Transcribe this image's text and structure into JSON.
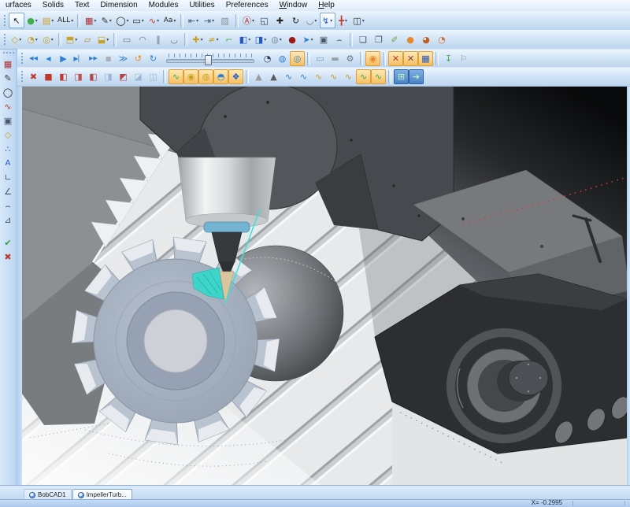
{
  "menubar": {
    "items": [
      {
        "label": "urfaces"
      },
      {
        "label": "Solids"
      },
      {
        "label": "Text"
      },
      {
        "label": "Dimension"
      },
      {
        "label": "Modules"
      },
      {
        "label": "Utilities"
      },
      {
        "label": "Preferences"
      },
      {
        "label": "Window",
        "u": 1
      },
      {
        "label": "Help",
        "u": 1
      }
    ]
  },
  "toolbars": {
    "row1": [
      {
        "t": "g"
      },
      {
        "t": "b",
        "n": "select-arrow-button",
        "g": "↖",
        "c": "#1a1a1a",
        "box": "blue"
      },
      {
        "t": "b",
        "n": "visibility-toggle-button",
        "g": "●",
        "c": "#3fae49",
        "dd": 1
      },
      {
        "t": "b",
        "n": "color-filter-button",
        "g": "▤",
        "c": "#caa020",
        "dd": 1
      },
      {
        "t": "b",
        "n": "selection-mask-dropdown",
        "g": "ALL",
        "c": "#222",
        "dd": 1,
        "fs": 9
      },
      {
        "t": "s"
      },
      {
        "t": "b",
        "n": "layer-manager-button",
        "g": "▦",
        "c": "#b03030",
        "dd": 1
      },
      {
        "t": "b",
        "n": "line-tool-button",
        "g": "✎",
        "c": "#333",
        "dd": 1
      },
      {
        "t": "b",
        "n": "circle-tool-button",
        "g": "◯",
        "c": "#1a1a1a",
        "dd": 1
      },
      {
        "t": "b",
        "n": "rectangle-tool-button",
        "g": "▭",
        "c": "#1a1a1a",
        "dd": 1
      },
      {
        "t": "b",
        "n": "spline-tool-button",
        "g": "∿",
        "c": "#c0392b",
        "dd": 1
      },
      {
        "t": "b",
        "n": "text-tool-button",
        "g": "Aa",
        "c": "#222",
        "dd": 1,
        "fs": 9
      },
      {
        "t": "s"
      },
      {
        "t": "b",
        "n": "dimension-horizontal-button",
        "g": "⇤",
        "c": "#445566",
        "dd": 1
      },
      {
        "t": "b",
        "n": "dimension-vertical-button",
        "g": "⇥",
        "c": "#445566",
        "dd": 1
      },
      {
        "t": "b",
        "n": "hatch-tool-button",
        "g": "▨",
        "c": "#8892a0"
      },
      {
        "t": "s"
      },
      {
        "t": "b",
        "n": "zoom-auto-button",
        "g": "Ⓐ",
        "c": "#b03030",
        "dd": 1
      },
      {
        "t": "b",
        "n": "zoom-window-button",
        "g": "◱",
        "c": "#334455"
      },
      {
        "t": "b",
        "n": "pan-view-button",
        "g": "✚",
        "c": "#222"
      },
      {
        "t": "b",
        "n": "rotate-view-button",
        "g": "↻",
        "c": "#222"
      },
      {
        "t": "b",
        "n": "orbit-view-button",
        "g": "◡",
        "c": "#667788",
        "dd": 1
      },
      {
        "t": "b",
        "n": "dynamic-ucs-button",
        "g": "↯",
        "c": "#2457c5",
        "box": "blue",
        "dd": 1
      },
      {
        "t": "b",
        "n": "axis-origin-button",
        "g": "╋",
        "c": "#c0392b",
        "dd": 1
      },
      {
        "t": "b",
        "n": "view-cube-button",
        "g": "◫",
        "c": "#333",
        "dd": 1
      }
    ],
    "row2": [
      {
        "t": "g"
      },
      {
        "t": "b",
        "n": "surface-plane-button",
        "g": "◇",
        "c": "#caa020",
        "dd": 1
      },
      {
        "t": "b",
        "n": "surface-revolve-button",
        "g": "◔",
        "c": "#caa020",
        "dd": 1
      },
      {
        "t": "b",
        "n": "surface-sweep-button",
        "g": "◎",
        "c": "#caa020",
        "dd": 1
      },
      {
        "t": "s"
      },
      {
        "t": "b",
        "n": "surface-loft-button",
        "g": "⬒",
        "c": "#caa020",
        "dd": 1
      },
      {
        "t": "b",
        "n": "surface-trim-button",
        "g": "▱",
        "c": "#b8860b"
      },
      {
        "t": "b",
        "n": "solid-extract-button",
        "g": "⬓",
        "c": "#caa020",
        "dd": 1
      },
      {
        "t": "s"
      },
      {
        "t": "b",
        "n": "relation-rect-button",
        "g": "▭",
        "c": "#6a7486"
      },
      {
        "t": "b",
        "n": "relation-arc-button",
        "g": "◠",
        "c": "#6a7486"
      },
      {
        "t": "b",
        "n": "relation-align-button",
        "g": "∥",
        "c": "#6a7486"
      },
      {
        "t": "b",
        "n": "relation-tangent-button",
        "g": "◡",
        "c": "#6a7486"
      },
      {
        "t": "s"
      },
      {
        "t": "b",
        "n": "trim-cross-button",
        "g": "✚",
        "c": "#caa020",
        "dd": 1
      },
      {
        "t": "b",
        "n": "trim-fence-button",
        "g": "≠",
        "c": "#caa020",
        "dd": 1
      },
      {
        "t": "b",
        "n": "extend-corner-button",
        "g": "⌐",
        "c": "#3fae49"
      },
      {
        "t": "b",
        "n": "solid-cube-button",
        "g": "◧",
        "c": "#2457c5",
        "dd": 1
      },
      {
        "t": "b",
        "n": "cube-rotate-button",
        "g": "◨",
        "c": "#2457c5",
        "dd": 1
      },
      {
        "t": "b",
        "n": "shrink-wrap-button",
        "g": "◍",
        "c": "#8899aa",
        "dd": 1
      },
      {
        "t": "b",
        "n": "blob-button",
        "g": "●",
        "c": "#a01818"
      },
      {
        "t": "b",
        "n": "direction-arrow-button",
        "g": "➤",
        "c": "#2e7fd0",
        "dd": 1
      },
      {
        "t": "b",
        "n": "stretch-select-button",
        "g": "▣",
        "c": "#445566"
      },
      {
        "t": "b",
        "n": "arc-flatten-button",
        "g": "⌢",
        "c": "#445566"
      },
      {
        "t": "s"
      },
      {
        "t": "b",
        "n": "group-create-button",
        "g": "❏",
        "c": "#445566"
      },
      {
        "t": "b",
        "n": "group-shield-button",
        "g": "❐",
        "c": "#445566"
      },
      {
        "t": "b",
        "n": "clean-sweep-button",
        "g": "✐",
        "c": "#7a9a4a"
      },
      {
        "t": "b",
        "n": "render-shaded-button",
        "g": "●",
        "c": "#e8882a"
      },
      {
        "t": "b",
        "n": "render-material-button",
        "g": "◕",
        "c": "#c06020"
      },
      {
        "t": "b",
        "n": "render-close-button",
        "g": "◔",
        "c": "#d07030"
      }
    ],
    "row3": [
      {
        "t": "g"
      },
      {
        "t": "b",
        "n": "sim-to-start-button",
        "g": "◀◀",
        "c": "#2e7fd0",
        "fs": 7
      },
      {
        "t": "b",
        "n": "sim-step-back-button",
        "g": "◀",
        "c": "#2e7fd0",
        "fs": 8
      },
      {
        "t": "b",
        "n": "sim-play-button",
        "g": "▶",
        "c": "#2e7fd0"
      },
      {
        "t": "b",
        "n": "sim-step-forward-button",
        "g": "▶▏",
        "c": "#2e7fd0",
        "fs": 8
      },
      {
        "t": "b",
        "n": "sim-to-end-button",
        "g": "▶▶",
        "c": "#2e7fd0",
        "fs": 7
      },
      {
        "t": "b",
        "n": "sim-stop-button",
        "g": "■",
        "c": "#a9b0b8",
        "fs": 8
      },
      {
        "t": "b",
        "n": "sim-fast-forward-button",
        "g": "≫",
        "c": "#2e7fd0"
      },
      {
        "t": "b",
        "n": "sim-loop-button",
        "g": "↺",
        "c": "#e8882a"
      },
      {
        "t": "b",
        "n": "sim-refresh-button",
        "g": "↻",
        "c": "#2e7fd0"
      },
      {
        "t": "sl",
        "n": "sim-speed-slider"
      },
      {
        "t": "b",
        "n": "sim-clock-button",
        "g": "◔",
        "c": "#333a55"
      },
      {
        "t": "b",
        "n": "sim-world-button",
        "g": "◍",
        "c": "#2e7fd0"
      },
      {
        "t": "b",
        "n": "sim-target-button",
        "g": "◎",
        "c": "#2e7fd0",
        "box": "orange"
      },
      {
        "t": "s"
      },
      {
        "t": "b",
        "n": "sim-erase-button",
        "g": "▭",
        "c": "#7a90b8"
      },
      {
        "t": "b",
        "n": "sim-stock-button",
        "g": "▬",
        "c": "#99a0a8"
      },
      {
        "t": "b",
        "n": "sim-settings-button",
        "g": "⚙",
        "c": "#667788"
      },
      {
        "t": "s"
      },
      {
        "t": "b",
        "n": "sim-compare-button",
        "g": "◉",
        "c": "#e8882a",
        "box": "orange"
      },
      {
        "t": "s"
      },
      {
        "t": "b",
        "n": "collision-check-button",
        "g": "✕",
        "c": "#c0392b",
        "box": "orange"
      },
      {
        "t": "b",
        "n": "collision-report-button",
        "g": "✕",
        "c": "#7a4444",
        "box": "orange"
      },
      {
        "t": "b",
        "n": "machine-housing-button",
        "g": "▦",
        "c": "#2457c5",
        "box": "orange"
      },
      {
        "t": "s"
      },
      {
        "t": "b",
        "n": "pin-toolbar-button",
        "g": "↧",
        "c": "#3fae49"
      },
      {
        "t": "b",
        "n": "flag-marker-button",
        "g": "⚐",
        "c": "#8a94a0"
      }
    ],
    "row4": [
      {
        "t": "g"
      },
      {
        "t": "b",
        "n": "exit-simulation-button",
        "g": "✖",
        "c": "#c0392b"
      },
      {
        "t": "b",
        "n": "view-cube-iso-button",
        "g": "■",
        "c": "#c0392b"
      },
      {
        "t": "b",
        "n": "view-cube-front-button",
        "g": "◧",
        "c": "#c0392b"
      },
      {
        "t": "b",
        "n": "view-cube-back-button",
        "g": "◨",
        "c": "#c05050"
      },
      {
        "t": "b",
        "n": "view-cube-left-button",
        "g": "◧",
        "c": "#b04848"
      },
      {
        "t": "b",
        "n": "view-cube-right-button",
        "g": "◨",
        "c": "#9bb7d4"
      },
      {
        "t": "b",
        "n": "view-cube-top-button",
        "g": "◩",
        "c": "#b04848"
      },
      {
        "t": "b",
        "n": "view-cube-bottom-button",
        "g": "◪",
        "c": "#9bb7d4"
      },
      {
        "t": "b",
        "n": "view-cube-iso2-button",
        "g": "◫",
        "c": "#9bb7d4"
      },
      {
        "t": "s"
      },
      {
        "t": "b",
        "n": "toolpath-edit-button",
        "g": "∿",
        "c": "#3fae49",
        "box": "orange"
      },
      {
        "t": "b",
        "n": "toolpath-verify-button",
        "g": "◉",
        "c": "#caa020",
        "box": "orange"
      },
      {
        "t": "b",
        "n": "toolpath-machine-button",
        "g": "◍",
        "c": "#caa020",
        "box": "orange"
      },
      {
        "t": "b",
        "n": "toolpath-stock-button",
        "g": "◓",
        "c": "#2e7fd0",
        "box": "orange"
      },
      {
        "t": "b",
        "n": "toolpath-post-button",
        "g": "❖",
        "c": "#2457c5",
        "box": "orange"
      },
      {
        "t": "s"
      },
      {
        "t": "b",
        "n": "tool-cone-red-button",
        "g": "▲",
        "c": "#9a9aa2"
      },
      {
        "t": "b",
        "n": "tool-cone-grey-button",
        "g": "▲",
        "c": "#5a5a62"
      },
      {
        "t": "b",
        "n": "path-blue-1-button",
        "g": "∿",
        "c": "#2e7fd0"
      },
      {
        "t": "b",
        "n": "path-blue-2-button",
        "g": "∿",
        "c": "#2e7fd0"
      },
      {
        "t": "b",
        "n": "path-tool-1-button",
        "g": "∿",
        "c": "#caa020"
      },
      {
        "t": "b",
        "n": "path-tool-2-button",
        "g": "∿",
        "c": "#caa020"
      },
      {
        "t": "b",
        "n": "path-tool-3-button",
        "g": "∿",
        "c": "#caa020"
      },
      {
        "t": "b",
        "n": "path-green-1-button",
        "g": "∿",
        "c": "#3fae49",
        "box": "orange"
      },
      {
        "t": "b",
        "n": "path-green-2-button",
        "g": "∿",
        "c": "#3fae49",
        "box": "orange"
      },
      {
        "t": "s"
      },
      {
        "t": "b",
        "n": "pattern-add-button",
        "g": "⊞",
        "c": "#bef4c0",
        "bg": "blue"
      },
      {
        "t": "b",
        "n": "pattern-post-button",
        "g": "➔",
        "c": "#bef4c0",
        "bg": "blue"
      }
    ],
    "left": [
      {
        "t": "g"
      },
      {
        "t": "b",
        "n": "side-layer-button",
        "g": "▦",
        "c": "#b03030"
      },
      {
        "t": "b",
        "n": "side-line-button",
        "g": "✎",
        "c": "#333"
      },
      {
        "t": "b",
        "n": "side-circle-button",
        "g": "◯",
        "c": "#1a1a1a"
      },
      {
        "t": "b",
        "n": "side-spline-button",
        "g": "∿",
        "c": "#c0392b"
      },
      {
        "t": "b",
        "n": "side-machine-button",
        "g": "▣",
        "c": "#445566"
      },
      {
        "t": "b",
        "n": "side-surface-button",
        "g": "◇",
        "c": "#caa020"
      },
      {
        "t": "b",
        "n": "side-points-button",
        "g": "∴",
        "c": "#2457c5"
      },
      {
        "t": "b",
        "n": "side-text-button",
        "g": "A",
        "c": "#2457c5",
        "fs": 10
      },
      {
        "t": "b",
        "n": "side-dim-linear-button",
        "g": "∟",
        "c": "#445566"
      },
      {
        "t": "b",
        "n": "side-dim-angular-button",
        "g": "∠",
        "c": "#445566"
      },
      {
        "t": "b",
        "n": "side-dim-radius-button",
        "g": "⌢",
        "c": "#445566"
      },
      {
        "t": "b",
        "n": "side-dim-note-button",
        "g": "⊿",
        "c": "#445566"
      },
      {
        "t": "gap"
      },
      {
        "t": "b",
        "n": "confirm-ok-button",
        "g": "✔",
        "c": "#2f9e3f"
      },
      {
        "t": "b",
        "n": "confirm-cancel-button",
        "g": "✖",
        "c": "#c0392b"
      }
    ]
  },
  "tabs": {
    "documents": [
      {
        "label": "BobCAD1",
        "active": false
      },
      {
        "label": "ImpellerTurb...",
        "active": true
      }
    ]
  },
  "statusbar": {
    "coordinate_x": "X= -0.2995"
  },
  "viewport": {
    "toolpath_color": "#38e2d6",
    "rapid_move_color": "#cc4433",
    "impeller_color": "#b9c3d0"
  },
  "colors": {
    "chrome_bg": "#cfe2f6",
    "chrome_accent": "#9ab6d8",
    "status_bg": "#b5cfee",
    "active_box_orange": "#e09f35",
    "active_box_blue": "#7da7d8"
  }
}
